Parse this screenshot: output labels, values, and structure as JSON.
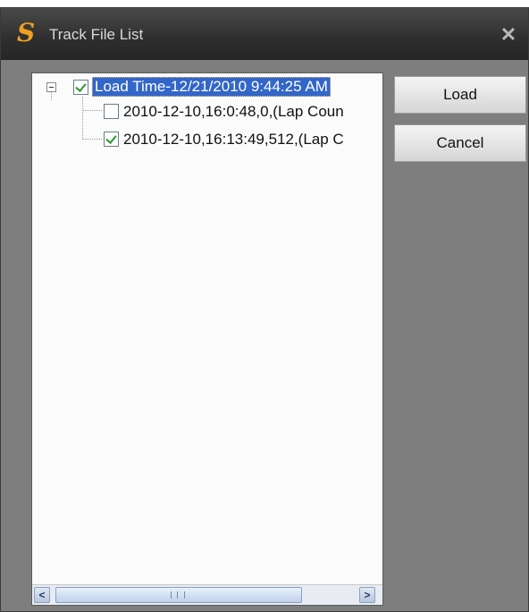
{
  "window": {
    "title": "Track File List",
    "app_icon_glyph": "S",
    "close_glyph": "✕"
  },
  "tree": {
    "root": {
      "label": "Load Time-12/21/2010 9:44:25 AM",
      "checked": true,
      "expanded": true
    },
    "children": [
      {
        "label": "2010-12-10,16:0:48,0,(Lap Coun",
        "checked": false
      },
      {
        "label": "2010-12-10,16:13:49,512,(Lap C",
        "checked": true
      }
    ]
  },
  "buttons": {
    "load_label": "Load",
    "cancel_label": "Cancel"
  },
  "scrollbar": {
    "left_arrow": "<",
    "right_arrow": ">"
  },
  "colors": {
    "selection": "#3266c8",
    "check": "#2a9a2a",
    "icon": "#f0a020"
  }
}
